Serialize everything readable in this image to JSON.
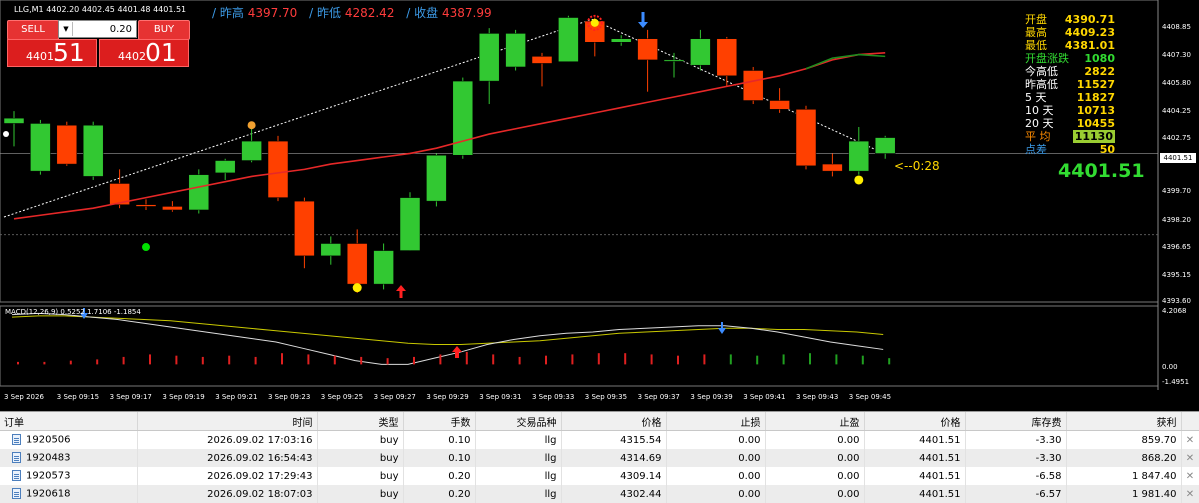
{
  "window": {
    "symbol_title": "LLG,M1  4402.20 4402.45 4401.48 4401.51"
  },
  "top_stats": [
    {
      "label": "/ 昨高",
      "value": "4397.70"
    },
    {
      "label": "/ 昨低",
      "value": "4282.42"
    },
    {
      "label": "/ 收盘",
      "value": "4387.99"
    }
  ],
  "trade_panel": {
    "sell_label": "SELL",
    "buy_label": "BUY",
    "lot_value": "0.20",
    "sell_small": "4401",
    "sell_big": "51",
    "buy_small": "4402",
    "buy_big": "01"
  },
  "right_panel": [
    {
      "key": "开盘",
      "value": "4390.71",
      "kcolor": "#ffd700",
      "vcolor": "#ffd700"
    },
    {
      "key": "最高",
      "value": "4409.23",
      "kcolor": "#ffd700",
      "vcolor": "#ffd700"
    },
    {
      "key": "最低",
      "value": "4381.01",
      "kcolor": "#ffd700",
      "vcolor": "#ffd700"
    },
    {
      "key": "开盘涨跌",
      "value": "1080",
      "kcolor": "#32dc32",
      "vcolor": "#32dc32"
    },
    {
      "key": "今高低",
      "value": "2822",
      "kcolor": "#ffffff",
      "vcolor": "#ffd700"
    },
    {
      "key": "昨高低",
      "value": "11527",
      "kcolor": "#ffffff",
      "vcolor": "#ffd700"
    },
    {
      "key": "5   天",
      "value": "11827",
      "kcolor": "#ffffff",
      "vcolor": "#ffd700"
    },
    {
      "key": "10  天",
      "value": "10713",
      "kcolor": "#ffffff",
      "vcolor": "#ffd700"
    },
    {
      "key": "20  天",
      "value": "10455",
      "kcolor": "#ffffff",
      "vcolor": "#ffd700"
    },
    {
      "key": "平   均",
      "value": "11130",
      "kcolor": "#ff8c00",
      "vcolor": "#32dc32"
    },
    {
      "key": "点差",
      "value": "50",
      "kcolor": "#3c9ae6",
      "vcolor": "#ffd700"
    }
  ],
  "big_price": "4401.51",
  "countdown": "<--0:28",
  "macd_label": "MACD(12,26,9) 0.5252 1.7106 -1.1854",
  "price_axis": [
    "4408.85",
    "4407.30",
    "4405.80",
    "4404.25",
    "4402.75",
    "4401.51",
    "4399.70",
    "4398.20",
    "4396.65",
    "4395.15",
    "4393.60"
  ],
  "macd_axis": [
    "4.2068",
    "0.00",
    "-1.4951"
  ],
  "time_axis": [
    "3 Sep 2026",
    "3 Sep 09:15",
    "3 Sep 09:17",
    "3 Sep 09:19",
    "3 Sep 09:21",
    "3 Sep 09:23",
    "3 Sep 09:25",
    "3 Sep 09:27",
    "3 Sep 09:29",
    "3 Sep 09:31",
    "3 Sep 09:33",
    "3 Sep 09:35",
    "3 Sep 09:37",
    "3 Sep 09:39",
    "3 Sep 09:41",
    "3 Sep 09:43",
    "3 Sep 09:45"
  ],
  "colors": {
    "bull": "#32c832",
    "bear": "#ff4000",
    "ma": "#e62828",
    "ma_tail": "#1e8c1e",
    "macd_main": "#dcdcdc",
    "macd_signal": "#c8c800"
  },
  "chart_data": {
    "type": "candlestick",
    "timeframe": "M1",
    "ylim": [
      4393.2,
      4409.4
    ],
    "candles": [
      {
        "t": "09:13",
        "o": 4403.2,
        "h": 4403.9,
        "l": 4401.9,
        "c": 4403.5
      },
      {
        "t": "09:14",
        "o": 4400.5,
        "h": 4403.4,
        "l": 4400.3,
        "c": 4403.2
      },
      {
        "t": "09:15",
        "o": 4403.1,
        "h": 4403.3,
        "l": 4400.8,
        "c": 4400.9
      },
      {
        "t": "09:16",
        "o": 4400.2,
        "h": 4403.3,
        "l": 4400.0,
        "c": 4403.1
      },
      {
        "t": "09:17",
        "o": 4399.8,
        "h": 4400.6,
        "l": 4398.4,
        "c": 4398.6
      },
      {
        "t": "09:18",
        "o": 4398.6,
        "h": 4398.9,
        "l": 4398.3,
        "c": 4398.5
      },
      {
        "t": "09:19",
        "o": 4398.5,
        "h": 4398.8,
        "l": 4398.2,
        "c": 4398.3
      },
      {
        "t": "09:20",
        "o": 4398.3,
        "h": 4400.6,
        "l": 4398.1,
        "c": 4400.3
      },
      {
        "t": "09:21",
        "o": 4400.4,
        "h": 4401.2,
        "l": 4400.0,
        "c": 4401.1
      },
      {
        "t": "09:22",
        "o": 4401.1,
        "h": 4402.9,
        "l": 4401.0,
        "c": 4402.2
      },
      {
        "t": "09:23",
        "o": 4402.2,
        "h": 4402.5,
        "l": 4398.8,
        "c": 4399.0
      },
      {
        "t": "09:24",
        "o": 4398.8,
        "h": 4399.0,
        "l": 4395.0,
        "c": 4395.7
      },
      {
        "t": "09:25",
        "o": 4395.7,
        "h": 4396.8,
        "l": 4395.2,
        "c": 4396.4
      },
      {
        "t": "09:26",
        "o": 4396.4,
        "h": 4397.2,
        "l": 4393.6,
        "c": 4394.1
      },
      {
        "t": "09:27",
        "o": 4394.1,
        "h": 4396.4,
        "l": 4393.8,
        "c": 4396.0
      },
      {
        "t": "09:28",
        "o": 4396.0,
        "h": 4399.3,
        "l": 4396.0,
        "c": 4399.0
      },
      {
        "t": "09:29",
        "o": 4398.8,
        "h": 4401.5,
        "l": 4398.5,
        "c": 4401.4
      },
      {
        "t": "09:30",
        "o": 4401.4,
        "h": 4405.8,
        "l": 4401.2,
        "c": 4405.6
      },
      {
        "t": "09:31",
        "o": 4405.6,
        "h": 4408.6,
        "l": 4404.3,
        "c": 4408.3
      },
      {
        "t": "09:32",
        "o": 4406.4,
        "h": 4408.5,
        "l": 4406.2,
        "c": 4408.3
      },
      {
        "t": "09:33",
        "o": 4407.0,
        "h": 4407.2,
        "l": 4405.3,
        "c": 4406.6
      },
      {
        "t": "09:34",
        "o": 4406.7,
        "h": 4409.3,
        "l": 4406.7,
        "c": 4409.2
      },
      {
        "t": "09:35",
        "o": 4409.0,
        "h": 4409.2,
        "l": 4407.0,
        "c": 4407.8
      },
      {
        "t": "09:36",
        "o": 4407.8,
        "h": 4408.2,
        "l": 4407.6,
        "c": 4408.0
      },
      {
        "t": "09:37",
        "o": 4408.0,
        "h": 4408.5,
        "l": 4405.0,
        "c": 4406.8
      },
      {
        "t": "09:38",
        "o": 4406.8,
        "h": 4407.2,
        "l": 4405.8,
        "c": 4406.8
      },
      {
        "t": "09:39",
        "o": 4406.5,
        "h": 4408.5,
        "l": 4406.2,
        "c": 4408.0
      },
      {
        "t": "09:40",
        "o": 4408.0,
        "h": 4408.1,
        "l": 4405.3,
        "c": 4405.9
      },
      {
        "t": "09:41",
        "o": 4406.2,
        "h": 4406.4,
        "l": 4404.3,
        "c": 4404.5
      },
      {
        "t": "09:42",
        "o": 4404.5,
        "h": 4405.2,
        "l": 4403.8,
        "c": 4404.0
      },
      {
        "t": "09:43",
        "o": 4404.0,
        "h": 4404.2,
        "l": 4400.6,
        "c": 4400.8
      },
      {
        "t": "09:44",
        "o": 4400.9,
        "h": 4401.5,
        "l": 4400.2,
        "c": 4400.5
      },
      {
        "t": "09:45",
        "o": 4400.5,
        "h": 4403.0,
        "l": 4400.3,
        "c": 4402.2
      },
      {
        "t": "09:46",
        "o": 4401.5,
        "h": 4402.5,
        "l": 4401.2,
        "c": 4402.4
      }
    ],
    "ma": [
      4397.8,
      4398.0,
      4398.2,
      4398.4,
      4398.7,
      4399.0,
      4399.3,
      4399.6,
      4399.9,
      4400.2,
      4400.4,
      4400.6,
      4400.9,
      4401.1,
      4401.3,
      4401.5,
      4401.8,
      4402.2,
      4402.6,
      4402.9,
      4403.2,
      4403.5,
      4403.8,
      4404.1,
      4404.4,
      4404.7,
      4405.0,
      4405.3,
      4405.6,
      4405.9,
      4406.3,
      4406.8,
      4407.1,
      4407.2
    ],
    "current_price": 4401.51,
    "macd": {
      "ylim": [
        -1.4951,
        4.2068
      ],
      "main": [
        4.0,
        4.1,
        4.0,
        3.8,
        3.6,
        3.3,
        3.0,
        2.7,
        2.4,
        2.1,
        1.8,
        1.3,
        0.8,
        0.3,
        0.0,
        0.0,
        0.5,
        1.0,
        1.6,
        2.0,
        2.3,
        2.5,
        2.6,
        2.8,
        2.9,
        3.0,
        3.1,
        3.1,
        2.9,
        2.6,
        2.2,
        1.8,
        1.5,
        1.2
      ],
      "signal": [
        3.8,
        3.9,
        3.9,
        3.8,
        3.7,
        3.6,
        3.5,
        3.3,
        3.1,
        2.9,
        2.7,
        2.5,
        2.3,
        2.1,
        1.9,
        1.7,
        1.6,
        1.6,
        1.7,
        1.8,
        1.9,
        2.1,
        2.3,
        2.5,
        2.6,
        2.7,
        2.8,
        2.9,
        2.9,
        2.8,
        2.8,
        2.7,
        2.6,
        2.4
      ],
      "hist": [
        0.2,
        0.2,
        0.3,
        0.4,
        0.6,
        0.8,
        0.7,
        0.6,
        0.7,
        0.6,
        0.9,
        0.8,
        0.7,
        0.6,
        0.5,
        0.6,
        0.8,
        1.0,
        0.8,
        0.6,
        0.7,
        0.8,
        0.9,
        0.9,
        0.8,
        0.7,
        0.8,
        0.8,
        0.7,
        0.8,
        0.9,
        0.8,
        0.7,
        0.5
      ]
    }
  },
  "table": {
    "headers": [
      "订单",
      "时间",
      "类型",
      "手数",
      "交易品种",
      "价格",
      "止损",
      "止盈",
      "价格",
      "库存费",
      "获利"
    ],
    "rows": [
      [
        "1920506",
        "2026.09.02 17:03:16",
        "buy",
        "0.10",
        "llg",
        "4315.54",
        "0.00",
        "0.00",
        "4401.51",
        "-3.30",
        "859.70"
      ],
      [
        "1920483",
        "2026.09.02 16:54:43",
        "buy",
        "0.10",
        "llg",
        "4314.69",
        "0.00",
        "0.00",
        "4401.51",
        "-3.30",
        "868.20"
      ],
      [
        "1920573",
        "2026.09.02 17:29:43",
        "buy",
        "0.20",
        "llg",
        "4309.14",
        "0.00",
        "0.00",
        "4401.51",
        "-6.58",
        "1 847.40"
      ],
      [
        "1920618",
        "2026.09.02 18:07:03",
        "buy",
        "0.20",
        "llg",
        "4302.44",
        "0.00",
        "0.00",
        "4401.51",
        "-6.57",
        "1 981.40"
      ]
    ]
  }
}
